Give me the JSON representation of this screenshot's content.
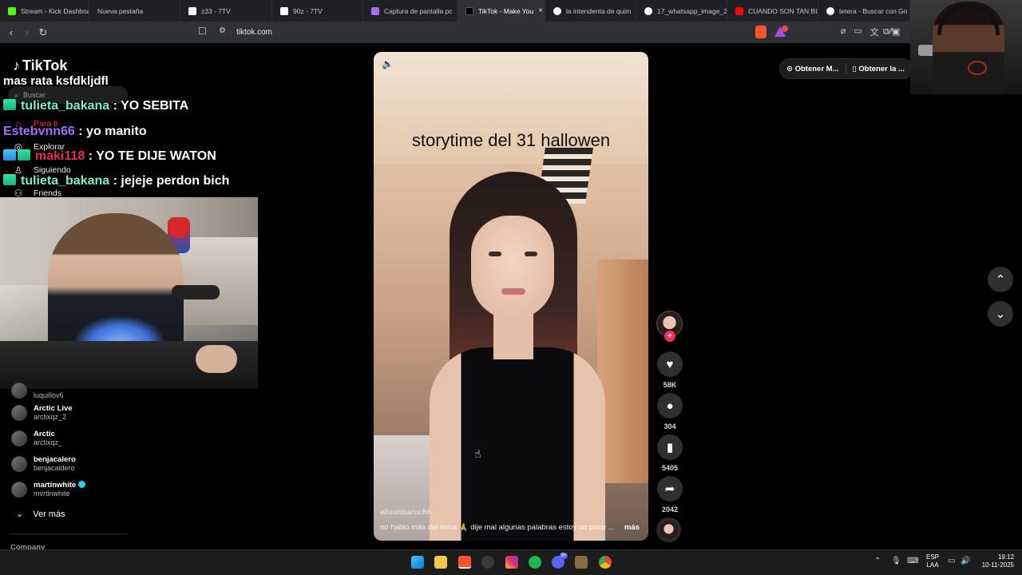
{
  "browser": {
    "tabs": [
      {
        "label": "Stream - Kick Dashboa",
        "color": "#53fc18"
      },
      {
        "label": "Nueva pestaña",
        "color": "#1f2023"
      },
      {
        "label": "z33 - 7TV",
        "color": "#ffffff"
      },
      {
        "label": "90z - 7TV",
        "color": "#ffffff"
      },
      {
        "label": "Captura de pantalla pc",
        "color": "#a86cf5"
      },
      {
        "label": "TikTok - Make You",
        "color": "#000000",
        "active": true
      },
      {
        "label": "la intendenta de quim",
        "color": "#ffffff"
      },
      {
        "label": "17_whatsapp_image_2",
        "color": "#ffffff"
      },
      {
        "label": "CUANDO SON TAN BU",
        "color": "#ff0000"
      },
      {
        "label": "tetera - Buscar con Go",
        "color": "#ffffff"
      }
    ],
    "close_glyph": "×",
    "url": "tiktok.com"
  },
  "tiktok": {
    "logo_text": "TikTok",
    "search_placeholder": "Buscar",
    "nav": [
      {
        "label": "Para ti",
        "icon": "home-icon"
      },
      {
        "label": "Explorar",
        "icon": "compass-icon"
      },
      {
        "label": "Siguiendo",
        "icon": "user-follow-icon"
      },
      {
        "label": "Friends",
        "icon": "friends-icon"
      }
    ],
    "following": [
      {
        "name": "",
        "handle": "luquillov6"
      },
      {
        "name": "Arctic Live",
        "handle": "arctixqz_2"
      },
      {
        "name": "Arctic",
        "handle": "arctixqz_"
      },
      {
        "name": "benjacalero",
        "handle": "benjacaldero"
      },
      {
        "name": "martinwhite",
        "handle": "mvrtinwhite",
        "verified": true
      }
    ],
    "see_more": "Ver más",
    "company": "Company",
    "get_buttons": [
      "Obtener M...",
      "Obtener la ..."
    ]
  },
  "chat": {
    "header": "mas rata ksfdkljdfl",
    "messages": [
      {
        "user": "tulieta_bakana",
        "text": ": YO SEBITA",
        "color": "#7ff0c5"
      },
      {
        "user": "Estebvnn66",
        "text": ": yo manito",
        "color": "#a66bff"
      },
      {
        "user": "maki118",
        "text": ": YO TE DIJE WATON",
        "color": "#e0314d"
      },
      {
        "user": "tulieta_bakana",
        "text": ": jejeje perdon bich",
        "color": "#7ff0c5"
      }
    ]
  },
  "video": {
    "overlay_title": "storytime del 31 hallowen",
    "author": "alisonbaruchh",
    "description": "no hablo más del tema 🙏 dije mal algunas palabras estoy un poco ...",
    "more": "más",
    "likes": "58K",
    "comments": "304",
    "saves": "5405",
    "shares": "2042"
  },
  "taskbar": {
    "lang_1": "ESP",
    "lang_2": "LAA",
    "time": "19:12",
    "date": "10-11-2025",
    "discord_badge": "9+"
  }
}
